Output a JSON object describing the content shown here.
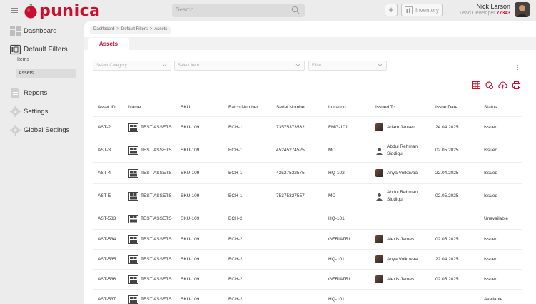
{
  "brand": {
    "name": "punica",
    "accent": "#c8102e"
  },
  "header": {
    "search_placeholder": "Search",
    "inventory_label": "Inventory",
    "user_name": "Nick Larson",
    "user_role": "Lead Developer",
    "user_id": "77343"
  },
  "sidebar": {
    "items": [
      {
        "label": "Dashboard",
        "icon": "dashboard-icon"
      },
      {
        "label": "Default Filters",
        "icon": "id-card-icon"
      },
      {
        "label": "Reports",
        "icon": "document-icon"
      },
      {
        "label": "Settings",
        "icon": "gear-icon"
      },
      {
        "label": "Global Settings",
        "icon": "gear-icon"
      }
    ],
    "sub_items": [
      "Items",
      "Assets"
    ]
  },
  "breadcrumb": [
    "Dashboard",
    ">",
    "Default Filters",
    ">",
    "Assets"
  ],
  "tab_label": "Assets",
  "filters": {
    "category_placeholder": "Select Category",
    "item_placeholder": "Select Item",
    "filter_placeholder": "Filter"
  },
  "table": {
    "columns": [
      "Asset ID",
      "Name",
      "SKU",
      "Batch Number",
      "Serial Number",
      "Location",
      "Issued To",
      "Issue Date",
      "Status"
    ],
    "rows": [
      {
        "id": "AST-2",
        "name": "TEST ASSETS",
        "sku": "SKU-109",
        "batch": "BCH-1",
        "serial": "73575373532",
        "location": "FMG-101",
        "issued_to": "Adam Jensen",
        "avatar": "photo",
        "date": "24.04.2025",
        "status": "Issued"
      },
      {
        "id": "AST-3",
        "name": "TEST ASSETS",
        "sku": "SKU-109",
        "batch": "BCH-1",
        "serial": "45245274525",
        "location": "MO",
        "issued_to": "Abdul Rehman Siddiqui",
        "avatar": "placeholder",
        "date": "02.05.2025",
        "status": "Issued"
      },
      {
        "id": "AST-4",
        "name": "TEST ASSETS",
        "sku": "SKU-109",
        "batch": "BCH-1",
        "serial": "43527532575",
        "location": "HQ-102",
        "issued_to": "Anya Volkovaa",
        "avatar": "photo",
        "date": "22.04.2025",
        "status": "Issued"
      },
      {
        "id": "AST-5",
        "name": "TEST ASSETS",
        "sku": "SKU-109",
        "batch": "BCH-1",
        "serial": "75375327557",
        "location": "MO",
        "issued_to": "Abdul Rehman Siddiqui",
        "avatar": "placeholder",
        "date": "02.05.2025",
        "status": "Issued"
      },
      {
        "id": "AST-533",
        "name": "TEST ASSETS",
        "sku": "SKU-109",
        "batch": "BCH-2",
        "serial": "",
        "location": "HQ-101",
        "issued_to": "",
        "avatar": "",
        "date": "",
        "status": "Unavailable"
      },
      {
        "id": "AST-534",
        "name": "TEST ASSETS",
        "sku": "SKU-109",
        "batch": "BCH-2",
        "serial": "",
        "location": "GERIATRI",
        "issued_to": "Alexis James",
        "avatar": "photo",
        "date": "02.05.2025",
        "status": "Issued"
      },
      {
        "id": "AST-535",
        "name": "TEST ASSETS",
        "sku": "SKU-109",
        "batch": "BCH-2",
        "serial": "",
        "location": "HQ-101",
        "issued_to": "Anya Volkovaa",
        "avatar": "photo",
        "date": "22.04.2025",
        "status": "Issued"
      },
      {
        "id": "AST-536",
        "name": "TEST ASSETS",
        "sku": "SKU-109",
        "batch": "BCH-2",
        "serial": "",
        "location": "GERIATRI",
        "issued_to": "Alexis James",
        "avatar": "photo",
        "date": "02.05.2025",
        "status": "Issued"
      },
      {
        "id": "AST-537",
        "name": "TEST ASSETS",
        "sku": "SKU-109",
        "batch": "BCH-2",
        "serial": "",
        "location": "HQ-101",
        "issued_to": "",
        "avatar": "",
        "date": "",
        "status": "Available"
      }
    ]
  }
}
